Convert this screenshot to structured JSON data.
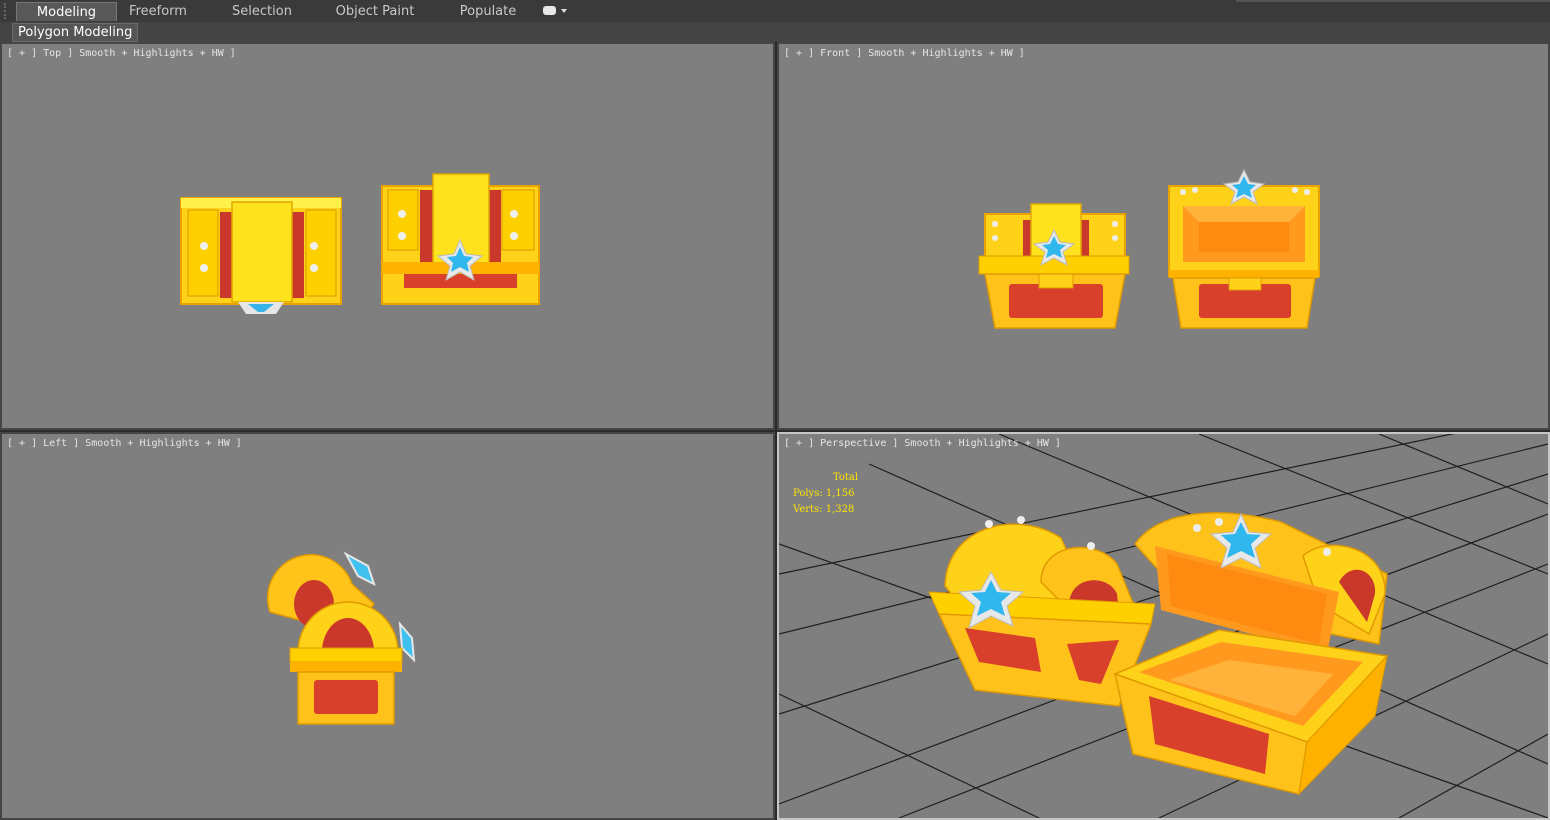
{
  "ribbon": {
    "tabs": [
      {
        "label": "Modeling",
        "active": true
      },
      {
        "label": "Freeform",
        "active": false
      },
      {
        "label": "Selection",
        "active": false
      },
      {
        "label": "Object Paint",
        "active": false
      },
      {
        "label": "Populate",
        "active": false
      }
    ],
    "panel_label": "Polygon Modeling"
  },
  "viewports": {
    "top": {
      "label": "[ + ] Top ] Smooth + Highlights + HW ]"
    },
    "front": {
      "label": "[ + ] Front ] Smooth + Highlights + HW ]"
    },
    "left": {
      "label": "[ + ] Left ] Smooth + Highlights + HW ]"
    },
    "perspective": {
      "label": "[ + ] Perspective ] Smooth + Highlights + HW ]"
    }
  },
  "stats": {
    "header": "Total",
    "polys_label": "Polys:",
    "polys_value": "1,156",
    "verts_label": "Verts:",
    "verts_value": "1,328"
  },
  "colors": {
    "viewport_bg": "#7f7f7f",
    "chest_gold": "#ffd21a",
    "chest_dark_gold": "#e8a300",
    "chest_red": "#d8402c",
    "gem_blue": "#2fb7ee",
    "stats_yellow": "#ffe400"
  }
}
